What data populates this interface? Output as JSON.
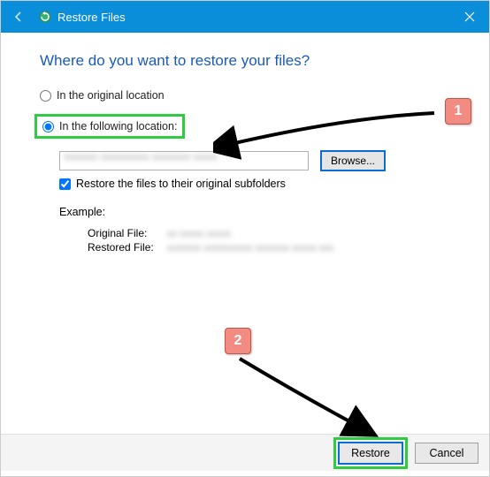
{
  "titlebar": {
    "title": "Restore Files"
  },
  "heading": "Where do you want to restore your files?",
  "options": {
    "original": "In the original location",
    "following": "In the following location:"
  },
  "browse_label": "Browse...",
  "checkbox_label": "Restore the files to their original subfolders",
  "example": {
    "title": "Example:",
    "original_label": "Original File:",
    "restored_label": "Restored File:"
  },
  "footer": {
    "restore": "Restore",
    "cancel": "Cancel"
  },
  "callouts": {
    "one": "1",
    "two": "2"
  }
}
